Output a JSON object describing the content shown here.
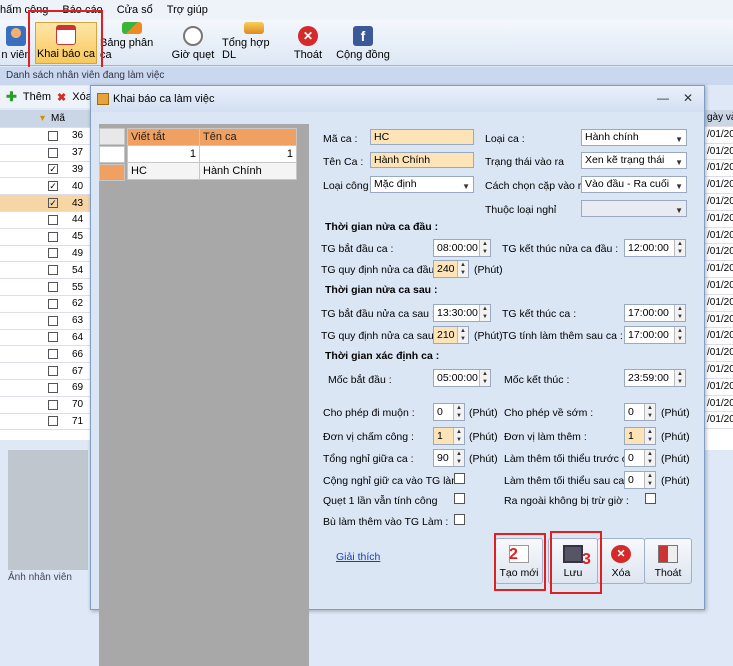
{
  "menubar": {
    "items": [
      "hấm công",
      "Báo cáo",
      "Cửa sổ",
      "Trợ giúp"
    ]
  },
  "toolbar": {
    "items": [
      {
        "label": "n viên",
        "icon": "user-icon"
      },
      {
        "label": "Khai báo ca",
        "icon": "calendar-icon"
      },
      {
        "label": "Bảng phân ca",
        "icon": "swap-arrows-icon"
      },
      {
        "label": "Giờ quẹt",
        "icon": "clock-icon"
      },
      {
        "label": "Tổng hợp DL",
        "icon": "lightning-icon"
      },
      {
        "label": "Thoát",
        "icon": "close-icon"
      },
      {
        "label": "Cộng đồng",
        "icon": "facebook-icon"
      }
    ]
  },
  "background": {
    "panel_title": "Danh sách nhân viên đang làm việc",
    "add_label": "Thêm",
    "delete_label": "Xóa",
    "col_header_partial": "Mã",
    "date_header_partial": "gày vào",
    "row_codes": [
      "36",
      "37",
      "39",
      "40",
      "43",
      "44",
      "45",
      "49",
      "54",
      "55",
      "62",
      "63",
      "64",
      "66",
      "67",
      "69",
      "70",
      "71"
    ],
    "row_checked": [
      false,
      false,
      true,
      true,
      true,
      false,
      false,
      false,
      false,
      false,
      false,
      false,
      false,
      false,
      false,
      false,
      false,
      false
    ],
    "date_values": [
      "/01/20",
      "/01/20",
      "/01/20",
      "/01/20",
      "/01/20",
      "/01/20",
      "/01/20",
      "/01/20",
      "/01/20",
      "/01/20",
      "/01/20",
      "/01/20",
      "/01/20",
      "/01/20",
      "/01/20",
      "/01/20",
      "/01/20",
      "/01/20"
    ],
    "photo_label": "Ảnh nhân viên"
  },
  "dialog": {
    "title": "Khai báo ca làm việc",
    "list": {
      "headers": [
        "Viết tắt",
        "Tên ca"
      ],
      "filter_row": [
        "1",
        "1"
      ],
      "rows": [
        [
          "HC",
          "Hành Chính"
        ]
      ]
    },
    "form": {
      "ma_ca_label": "Mã ca :",
      "ma_ca_value": "HC",
      "ten_ca_label": "Tên Ca :",
      "ten_ca_value": "Hành Chính",
      "loai_cong_label": "Loại công",
      "loai_cong_value": "Mặc định",
      "loai_ca_label": "Loại ca :",
      "loai_ca_value": "Hành chính",
      "trang_thai_label": "Trạng thái vào ra",
      "trang_thai_value": "Xen kẽ trạng thái",
      "cach_chon_label": "Cách chọn cặp vào ra",
      "cach_chon_value": "Vào đầu - Ra cuối",
      "thuoc_loai_nghi_label": "Thuộc loại nghỉ",
      "thuoc_loai_nghi_value": "",
      "sec1": "Thời gian nửa ca đầu :",
      "tg_bat_dau_ca_label": "TG bắt đầu ca :",
      "tg_bat_dau_ca_value": "08:00:00",
      "tg_kt_nua_ca_dau_label": "TG kết thúc nửa ca đầu :",
      "tg_kt_nua_ca_dau_value": "12:00:00",
      "tg_qd_nua_ca_dau_label": "TG quy định nửa ca đầu :",
      "tg_qd_nua_ca_dau_value": "240",
      "phut": "(Phút)",
      "sec2": "Thời gian nửa ca sau :",
      "tg_bd_nua_ca_sau_label": "TG bắt đầu nửa ca sau :",
      "tg_bd_nua_ca_sau_value": "13:30:00",
      "tg_kt_ca_label": "TG kết thúc ca :",
      "tg_kt_ca_value": "17:00:00",
      "tg_qd_nua_ca_sau_label": "TG quy định nửa ca sau :",
      "tg_qd_nua_ca_sau_value": "210",
      "tg_tinh_lam_them_label": "TG tính làm thêm sau ca :",
      "tg_tinh_lam_them_value": "17:00:00",
      "sec3": "Thời gian xác định ca :",
      "moc_bd_label": "Mốc bắt đầu :",
      "moc_bd_value": "05:00:00",
      "moc_kt_label": "Mốc kết thúc :",
      "moc_kt_value": "23:59:00",
      "di_muon_label": "Cho phép đi muộn :",
      "di_muon_value": "0",
      "ve_som_label": "Cho phép về sớm :",
      "ve_som_value": "0",
      "dv_cham_cong_label": "Đơn vị chấm công :",
      "dv_cham_cong_value": "1",
      "dv_lam_them_label": "Đơn vị làm thêm :",
      "dv_lam_them_value": "1",
      "tong_nghi_label": "Tổng nghỉ giữa ca :",
      "tong_nghi_value": "90",
      "lt_truoc_ca_label": "Làm thêm tối thiểu trước ca :",
      "lt_truoc_ca_value": "0",
      "lt_sau_ca_label": "Làm thêm tối thiểu sau ca :",
      "lt_sau_ca_value": "0",
      "cong_nghi_label": "Cộng nghỉ giữ ca vào TG làm :",
      "quet1_label": "Quẹt 1 lần vẫn tính công",
      "ra_ngoai_label": "Ra ngoài không bị trừ giờ :",
      "bu_lam_them_label": "Bù làm thêm vào TG Làm :",
      "giai_thich": "Giải thích"
    },
    "actions": {
      "new": "Tạo mới",
      "save": "Lưu",
      "delete": "Xóa",
      "exit": "Thoát"
    },
    "annotations": {
      "n1": "1",
      "n2": "2",
      "n3": "3"
    }
  },
  "colors": {
    "accent": "#f0a060",
    "highlight": "#fde4b8",
    "annotation": "#e02020"
  }
}
